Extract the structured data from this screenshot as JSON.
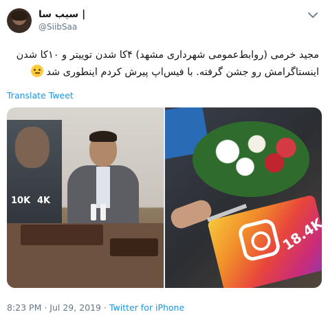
{
  "tweet": {
    "display_name": "سیب سا |",
    "handle": "@SiibSaa",
    "text_line1": "مجید خرمی (روابط‌عمومی شهرداری مشهد) ۴کا شدن توییتر و ۱۰کا شدن",
    "text_line2": "اینستاگرامش رو جشن گرفته. با فیس‌اپ پیرش کردم اینطوری شد",
    "translate_label": "Translate Tweet",
    "timestamp": "8:23 PM · Jul 29, 2019 ·",
    "source": "Twitter for iPhone"
  },
  "media": {
    "left_photo": {
      "poster_stat_1": "10K",
      "poster_stat_2": "4K"
    },
    "right_photo": {
      "cake_label": "18.4K"
    }
  },
  "icons": {
    "chevron": "chevron-down-icon",
    "avatar": "avatar",
    "emoji": "thinking-face-emoji"
  },
  "colors": {
    "link": "#1b95e0",
    "secondary_text": "#657786",
    "primary_text": "#14171a"
  }
}
